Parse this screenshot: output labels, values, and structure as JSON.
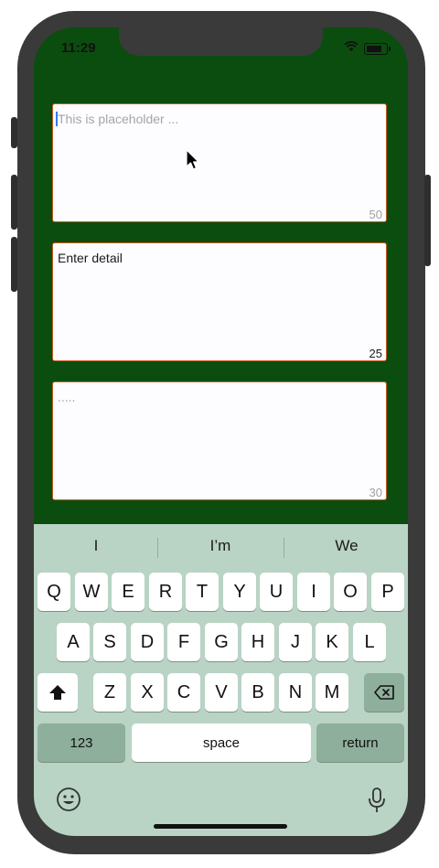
{
  "status": {
    "time": "11:29",
    "dots": "····"
  },
  "fields": [
    {
      "placeholder": "This is placeholder ...",
      "value": "",
      "counter": "50"
    },
    {
      "placeholder": "",
      "value": "Enter detail",
      "counter": "25"
    },
    {
      "placeholder": ".....",
      "value": "",
      "counter": "30"
    }
  ],
  "suggestions": [
    "I",
    "I’m",
    "We"
  ],
  "keyboard": {
    "row1": [
      "Q",
      "W",
      "E",
      "R",
      "T",
      "Y",
      "U",
      "I",
      "O",
      "P"
    ],
    "row2": [
      "A",
      "S",
      "D",
      "F",
      "G",
      "H",
      "J",
      "K",
      "L"
    ],
    "row3": [
      "Z",
      "X",
      "C",
      "V",
      "B",
      "N",
      "M"
    ],
    "numbers_label": "123",
    "space_label": "space",
    "return_label": "return"
  },
  "colors": {
    "background": "#0a4d0e",
    "border": "#c45a1c",
    "keyboard": "#b9d3c4"
  },
  "icons": [
    "wifi-icon",
    "battery-icon",
    "shift-icon",
    "backspace-icon",
    "emoji-icon",
    "microphone-icon",
    "mouse-cursor-icon"
  ]
}
